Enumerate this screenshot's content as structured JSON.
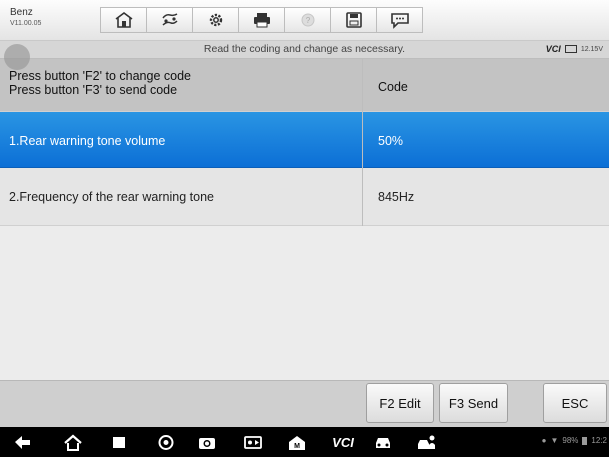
{
  "app": {
    "name": "Benz",
    "version": "V11.00.05"
  },
  "toolbar": {
    "icons": [
      "home-icon",
      "vehicle-swap-icon",
      "settings-icon",
      "print-icon",
      "help-icon",
      "save-icon",
      "message-icon"
    ]
  },
  "infobar": {
    "message": "Read the coding and change as necessary.",
    "vci_label": "VCI",
    "voltage": "12.15V"
  },
  "table": {
    "header": {
      "line1": "Press button 'F2' to change code",
      "line2": "Press button 'F3' to send code",
      "value": "Code"
    },
    "rows": [
      {
        "label": "1.Rear warning tone volume",
        "value": "50%",
        "selected": true
      },
      {
        "label": "2.Frequency of the rear warning tone",
        "value": "845Hz",
        "selected": false
      }
    ]
  },
  "buttons": {
    "f2": "F2 Edit",
    "f3": "F3 Send",
    "esc": "ESC"
  },
  "navbar": {
    "icons": [
      "back-icon",
      "home-icon",
      "recent-apps-icon",
      "browser-icon",
      "camera-icon",
      "screen-capture-icon",
      "maxisys-home-icon",
      "vci-icon",
      "car-icon",
      "remote-service-icon"
    ],
    "vci_label": "VCI",
    "battery": "98%",
    "time": "12:2"
  },
  "colors": {
    "selected_row": "#1a82dc",
    "header_row": "#c3c3c3"
  }
}
